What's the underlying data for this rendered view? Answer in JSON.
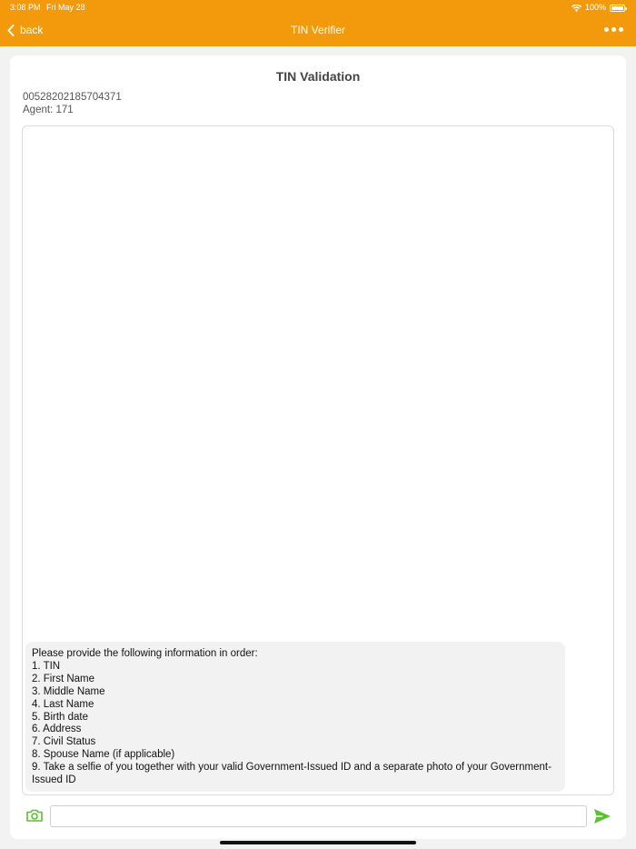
{
  "status_bar": {
    "time": "3:08 PM",
    "date": "Fri May 28",
    "battery": "100%"
  },
  "nav": {
    "back_label": "back",
    "title": "TIN Verifier"
  },
  "page": {
    "title": "TIN Validation",
    "id_number": "00528202185704371",
    "agent": "Agent:  171"
  },
  "message": {
    "lines": [
      "Please provide the following information in order:",
      "1. TIN",
      "2. First Name",
      "3. Middle Name",
      "4. Last Name",
      "5. Birth date",
      "6. Address",
      "7. Civil Status",
      "8. Spouse Name (if applicable)",
      "9. Take a selfie of you together with your valid Government-Issued ID and a separate photo of your Government-",
      "Issued ID"
    ]
  },
  "composer": {
    "value": "",
    "placeholder": ""
  },
  "colors": {
    "accent": "#f39a0c",
    "send": "#5cc12e",
    "camera": "#5cc12e"
  }
}
